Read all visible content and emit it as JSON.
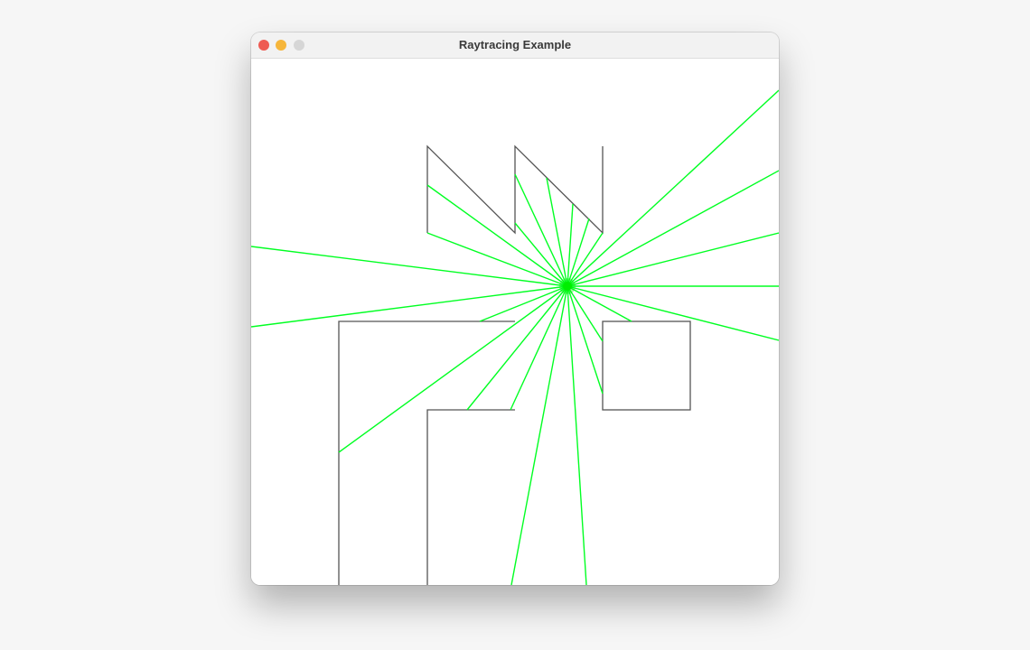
{
  "window": {
    "title": "Raytracing Example",
    "controls": {
      "close_color": "#ee5b52",
      "minimize_color": "#f6b63b",
      "maximize_color": "#d6d6d6"
    }
  },
  "scene": {
    "wall_color": "#555555",
    "ray_color": "#00ff22",
    "light_color": "#00ee00",
    "ray_count": 24,
    "background_color": "#ffffff"
  }
}
